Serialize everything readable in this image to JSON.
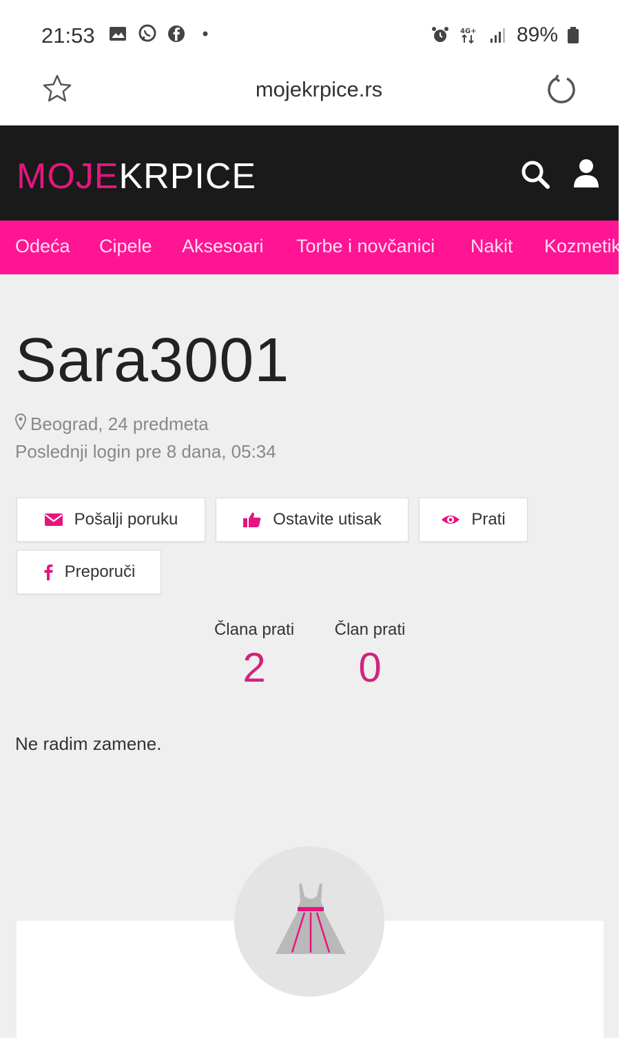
{
  "status_bar": {
    "time": "21:53",
    "battery": "89%",
    "left_icons": [
      "image-icon",
      "viber-icon",
      "facebook-icon",
      "dot-icon"
    ],
    "right_icons": [
      "alarm-icon",
      "4g-icon",
      "signal-icon",
      "battery-icon"
    ]
  },
  "browser": {
    "url": "mojekrpice.rs"
  },
  "header": {
    "logo_part1": "MOJE",
    "logo_part2": "KRPICE"
  },
  "nav": {
    "items": [
      "Odeća",
      "Cipele",
      "Aksesoari",
      "Torbe i novčanici",
      "Nakit",
      "Kozmetika"
    ]
  },
  "profile": {
    "username": "Sara3001",
    "location_items": "Beograd, 24 predmeta",
    "last_login": "Poslednji login pre 8 dana, 05:34",
    "about": "Ne radim zamene."
  },
  "actions": {
    "send_message": "Pošalji poruku",
    "leave_feedback": "Ostavite utisak",
    "follow": "Prati",
    "recommend": "Preporuči"
  },
  "stats": {
    "following_label": "Člana prati",
    "following_value": "2",
    "followers_label": "Član prati",
    "followers_value": "0"
  },
  "colors": {
    "accent": "#e5157f",
    "nav_bg": "#ff1493",
    "header_bg": "#1a1a1a",
    "stat_value": "#d1247b"
  }
}
